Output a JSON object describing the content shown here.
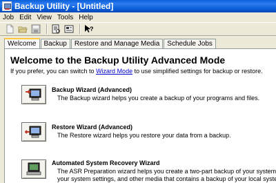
{
  "window": {
    "title": "Backup Utility - [Untitled]"
  },
  "menu": {
    "items": [
      "Job",
      "Edit",
      "View",
      "Tools",
      "Help"
    ]
  },
  "toolbar": {
    "icons": [
      "new-icon",
      "open-icon",
      "save-icon",
      "report-icon",
      "options-icon",
      "whats-this-help-icon"
    ]
  },
  "tabs": [
    "Welcome",
    "Backup",
    "Restore and Manage Media",
    "Schedule Jobs"
  ],
  "active_tab": "Welcome",
  "welcome": {
    "title": "Welcome to the Backup Utility Advanced Mode",
    "intro_before": "If you prefer, you can switch to ",
    "intro_link": "Wizard Mode",
    "intro_after": " to use simplified settings for backup or restore."
  },
  "wizards": [
    {
      "title": "Backup Wizard (Advanced)",
      "desc": "The Backup wizard helps you create a backup of your programs and files."
    },
    {
      "title": "Restore Wizard (Advanced)",
      "desc": "The Restore wizard helps you restore your data from a backup."
    },
    {
      "title": "Automated System Recovery Wizard",
      "desc1": "The ASR Preparation wizard helps you create a two-part backup of your system: a floppy disk that has",
      "desc2": "your system settings, and other media that contains a backup of your local system partition."
    }
  ]
}
